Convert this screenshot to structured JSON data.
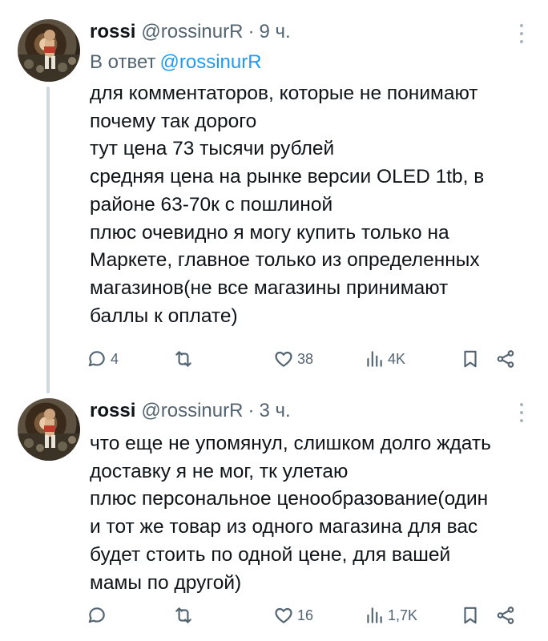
{
  "tweets": [
    {
      "name": "rossi",
      "handle": "@rossinurR",
      "separator": "·",
      "time": "9 ч.",
      "reply_prefix": "В ответ",
      "reply_mention": "@rossinurR",
      "lines": [
        "для комментаторов, которые не понимают",
        "почему так дорого",
        "тут цена 73 тысячи рублей",
        "средняя цена на рынке версии OLED 1tb, в",
        "районе 63-70к с пошлиной",
        "плюс очевидно я могу купить только на",
        "Маркете, главное только из определенных",
        "магазинов(не все магазины принимают",
        "баллы к оплате)"
      ],
      "stats": {
        "replies": "4",
        "retweets": "",
        "likes": "38",
        "views": "4K"
      }
    },
    {
      "name": "rossi",
      "handle": "@rossinurR",
      "separator": "·",
      "time": "3 ч.",
      "lines": [
        "что еще не упомянул, слишком долго ждать",
        "доставку я не мог, тк улетаю",
        "плюс персональное ценообразование(один",
        "и тот же товар из одного магазина для вас",
        "будет стоить по одной цене, для вашей",
        "мамы по другой)"
      ],
      "stats": {
        "replies": "",
        "retweets": "",
        "likes": "16",
        "views": "1,7K"
      }
    }
  ],
  "colors": {
    "text": "#0f1419",
    "secondary": "#536471",
    "link": "#1d9bf0",
    "thread_line": "#cfd9de"
  },
  "icons": [
    "reply-icon",
    "retweet-icon",
    "like-icon",
    "views-icon",
    "bookmark-icon",
    "share-icon",
    "more-icon"
  ]
}
